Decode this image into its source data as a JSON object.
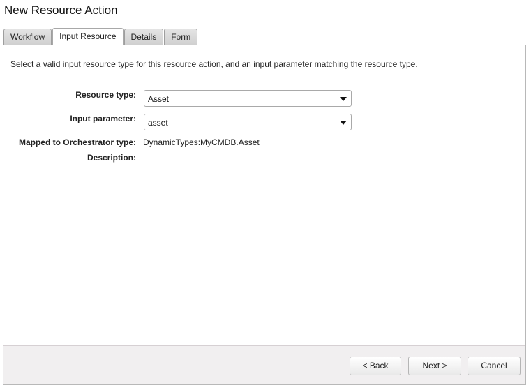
{
  "dialog": {
    "title": "New Resource Action"
  },
  "tabs": [
    {
      "label": "Workflow",
      "active": false
    },
    {
      "label": "Input Resource",
      "active": true
    },
    {
      "label": "Details",
      "active": false
    },
    {
      "label": "Form",
      "active": false
    }
  ],
  "content": {
    "instructions": "Select a valid input resource type for this resource action, and an input parameter matching the resource type.",
    "resource_type": {
      "label": "Resource type:",
      "value": "Asset"
    },
    "input_parameter": {
      "label": "Input parameter:",
      "value": "asset"
    },
    "mapped_type": {
      "label": "Mapped to Orchestrator type:",
      "value": "DynamicTypes:MyCMDB.Asset"
    },
    "description": {
      "label": "Description:",
      "value": ""
    }
  },
  "footer": {
    "back_label": "< Back",
    "next_label": "Next >",
    "cancel_label": "Cancel"
  },
  "colors": {
    "footer_bg": "#f1eff0",
    "tab_inactive_bg": "#d8d8d8",
    "panel_border": "#b8b8b8"
  }
}
